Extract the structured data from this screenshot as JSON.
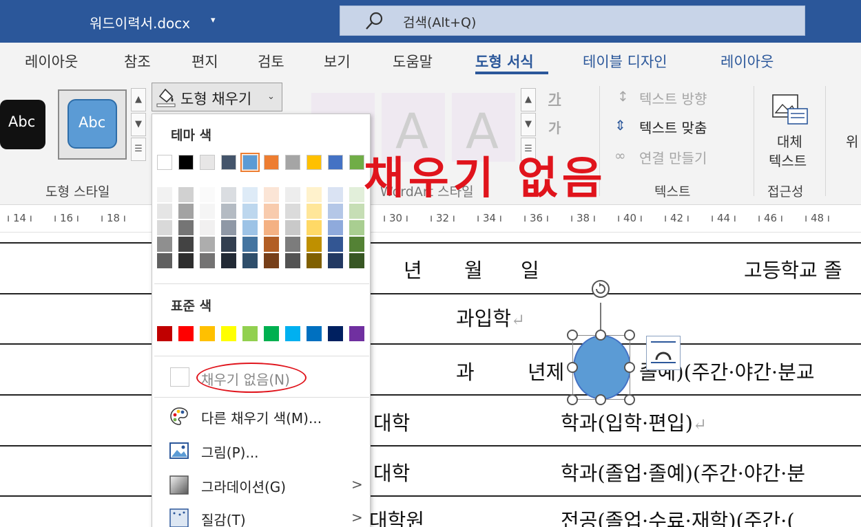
{
  "window": {
    "title": "워드이력서.docx",
    "title_caret": "▾"
  },
  "search": {
    "placeholder": "검색(Alt+Q)"
  },
  "tabs": [
    {
      "label": "레이아웃"
    },
    {
      "label": "참조"
    },
    {
      "label": "편지"
    },
    {
      "label": "검토"
    },
    {
      "label": "보기"
    },
    {
      "label": "도움말"
    },
    {
      "label": "도형 서식",
      "active": true
    },
    {
      "label": "테이블 디자인"
    },
    {
      "label": "레이아웃"
    }
  ],
  "ribbon": {
    "shape_styles": {
      "preset_1": "Abc",
      "preset_2": "Abc",
      "group_label": "도형 스타일"
    },
    "fill_button": {
      "label": "도형 채우기",
      "caret": "⌄"
    },
    "wordart": {
      "letter_a": "A",
      "letter_b": "A",
      "group_label": "WordArt 스타일",
      "text_fill_glyph": "가",
      "text_outline_glyph": "가"
    },
    "text": {
      "direction": "텍스트 방향",
      "align": "텍스트 맞춤",
      "link": "연결 만들기",
      "group_label": "텍스트"
    },
    "accessibility": {
      "alt_text_line1": "대체",
      "alt_text_line2": "텍스트",
      "group_label": "접근성"
    },
    "cut_off": "위"
  },
  "ruler": {
    "ticks": [
      "14",
      "16",
      "18",
      "30",
      "32",
      "34",
      "36",
      "38",
      "40",
      "42",
      "44",
      "46",
      "48"
    ]
  },
  "document": {
    "row1_year": "년",
    "row1_month": "월",
    "row1_day": "일",
    "row1_school": "고등학교 졸",
    "row2_text": "과입학",
    "row3_a": "과",
    "row3_b": "년제",
    "row3_c": "졸예)(주간·야간·분교",
    "row4_a": "대학",
    "row4_b": "학과(입학·편입)",
    "row5_a": "대학",
    "row5_b": "학과(졸업·졸예)(주간·야간·분",
    "row6_a": "대학원",
    "row6_b": "전공(졸업·수료·재학)(주간·(",
    "pilcrow": "↵"
  },
  "fill_menu": {
    "theme_heading": "테마 색",
    "theme_colors": [
      "#ffffff",
      "#000000",
      "#e7e6e6",
      "#44546a",
      "#5b9bd5",
      "#ed7d31",
      "#a5a5a5",
      "#ffc000",
      "#4472c4",
      "#70ad47"
    ],
    "standard_heading": "표준 색",
    "standard_colors": [
      "#c00000",
      "#ff0000",
      "#ffc000",
      "#ffff00",
      "#92d050",
      "#00b050",
      "#00b0f0",
      "#0070c0",
      "#002060",
      "#7030a0"
    ],
    "no_fill": "채우기 없음(N)",
    "more_colors": "다른 채우기 색(M)...",
    "picture": "그림(P)...",
    "gradient": "그라데이션(G)",
    "texture": "질감(T)"
  },
  "annotation": {
    "text": "채우기 없음"
  }
}
